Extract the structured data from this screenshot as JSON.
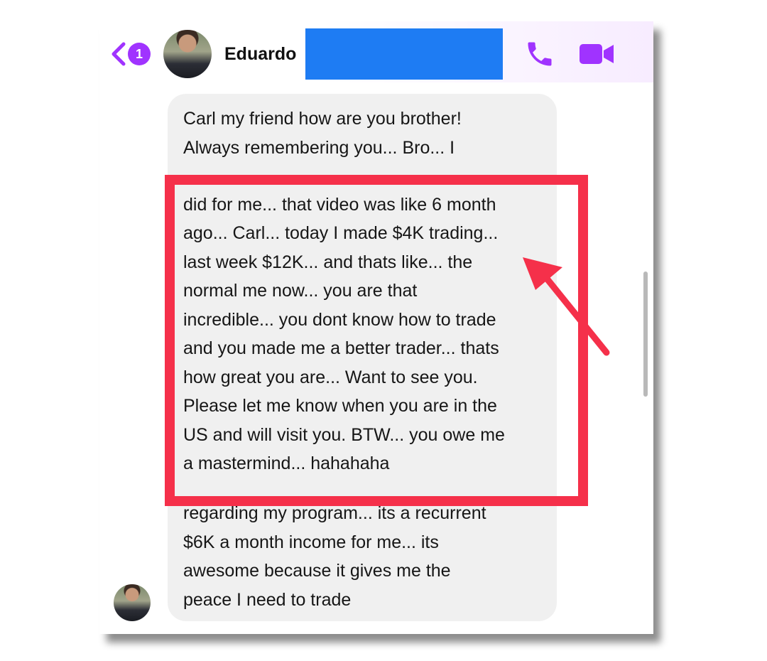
{
  "header": {
    "back_badge_count": "1",
    "contact_name": "Eduardo"
  },
  "colors": {
    "accent": "#a033ff",
    "highlight": "#f5304a",
    "redaction": "#1e7cf3",
    "bubble": "#f0f0f0"
  },
  "icons": [
    "back-chevron-icon",
    "phone-icon",
    "video-camera-icon"
  ],
  "message": {
    "lines": [
      "Carl my friend how are you brother!",
      "Always remembering you... Bro... I",
      "did for me... that video was like 6 month",
      "ago... Carl... today I made $4K trading...",
      "last week $12K... and thats like... the",
      "normal me now... you are that",
      "incredible... you dont know how to trade",
      "and you made me a better trader... thats",
      "how great you are... Want to see you.",
      "Please let me know when you are in the",
      "US and will visit you. BTW... you owe me",
      "a mastermind... hahahaha",
      "regarding my program... its a recurrent",
      "$6K a month  income for me... its",
      "awesome because it gives me the",
      "peace I need to trade"
    ]
  }
}
